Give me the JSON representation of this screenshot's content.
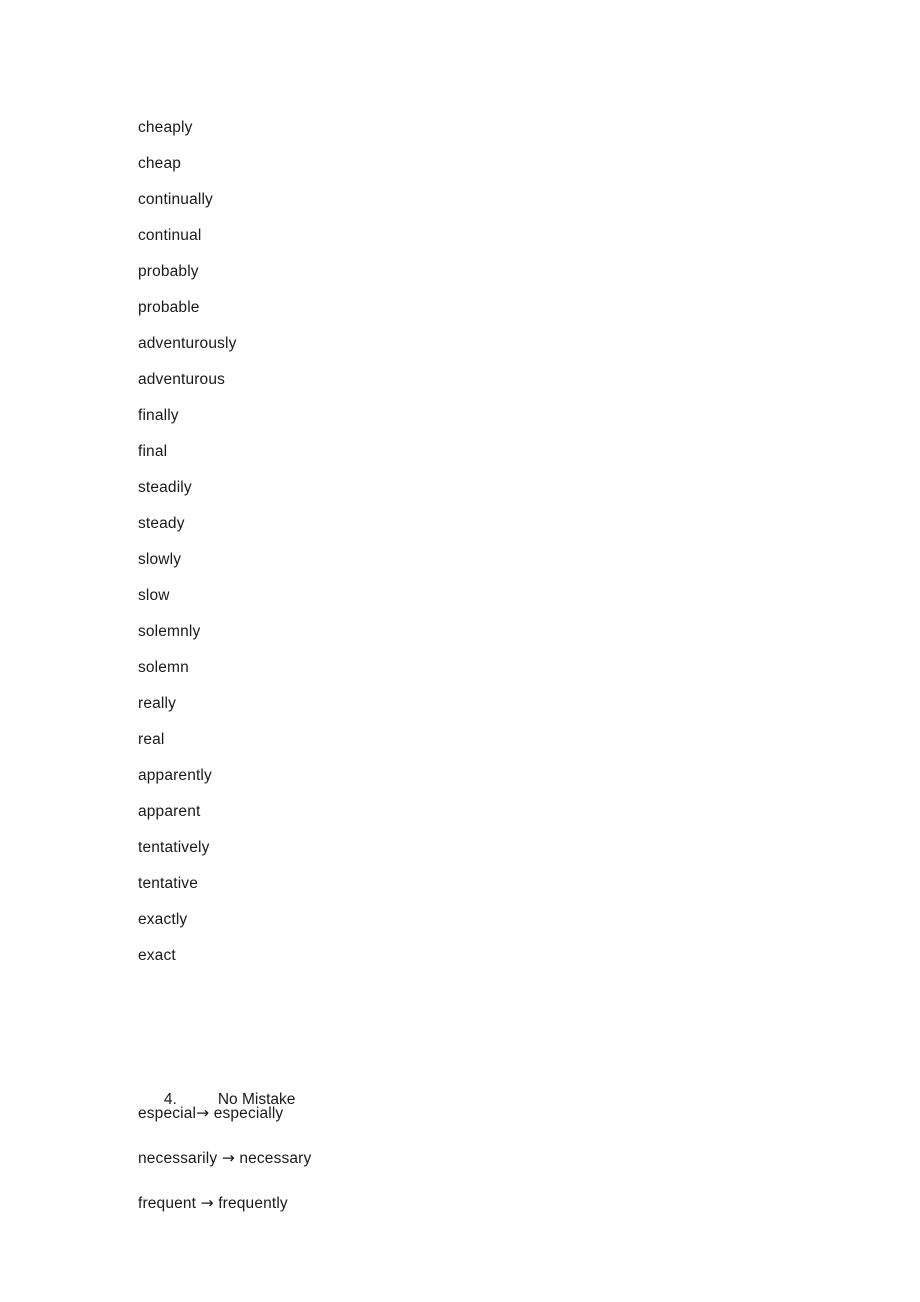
{
  "document": {
    "background_color": "#ffffff",
    "text_color": "#1a1a1a"
  },
  "word_list": [
    {
      "text": "cheaply"
    },
    {
      "text": "cheap"
    },
    {
      "text": "continually"
    },
    {
      "text": "continual"
    },
    {
      "text": "probably"
    },
    {
      "text": "probable"
    },
    {
      "text": "adventurously"
    },
    {
      "text": "adventurous"
    },
    {
      "text": "finally"
    },
    {
      "text": "final"
    },
    {
      "text": "steadily"
    },
    {
      "text": "steady"
    },
    {
      "text": "slowly"
    },
    {
      "text": "slow"
    },
    {
      "text": "solemnly"
    },
    {
      "text": "solemn"
    },
    {
      "text": "really"
    },
    {
      "text": "real"
    },
    {
      "text": "apparently"
    },
    {
      "text": "apparent"
    },
    {
      "text": "tentatively"
    },
    {
      "text": "tentative"
    },
    {
      "text": "exactly"
    },
    {
      "text": "exact"
    }
  ],
  "section": {
    "number": "4.",
    "title": "No Mistake"
  },
  "corrections": [
    {
      "from": "especial",
      "arrow": "→",
      "to": " especially",
      "gap_before_arrow": ""
    },
    {
      "from": "necessarily",
      "arrow": "→",
      "to": " necessary",
      "gap_before_arrow": " "
    },
    {
      "from": "frequent",
      "arrow": "→",
      "to": " frequently",
      "gap_before_arrow": " "
    }
  ]
}
